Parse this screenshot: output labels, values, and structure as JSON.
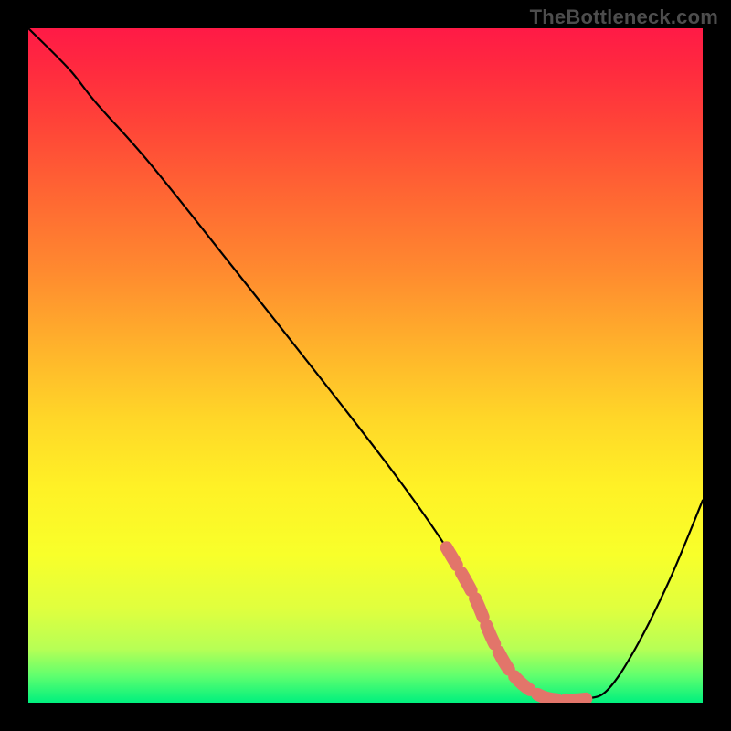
{
  "attribution": "TheBottleneck.com",
  "chart_data": {
    "type": "line",
    "title": "",
    "xlabel": "",
    "ylabel": "",
    "xlim": [
      0,
      100
    ],
    "ylim": [
      0,
      100
    ],
    "series": [
      {
        "name": "curve",
        "x": [
          0,
          6,
          10,
          18,
          30,
          45,
          55,
          62,
          66,
          69,
          72,
          76,
          80,
          83,
          86,
          90,
          95,
          100
        ],
        "y": [
          100,
          94,
          89,
          80,
          65,
          46,
          33,
          23,
          16,
          9,
          4,
          1,
          0.4,
          0.6,
          2,
          8,
          18,
          30
        ]
      }
    ],
    "highlight_segment": {
      "note": "thick salmon band near the minimum",
      "x": [
        62,
        66,
        69,
        72,
        76,
        80,
        83
      ],
      "y": [
        23,
        16,
        9,
        4,
        1,
        0.4,
        0.6
      ]
    }
  }
}
